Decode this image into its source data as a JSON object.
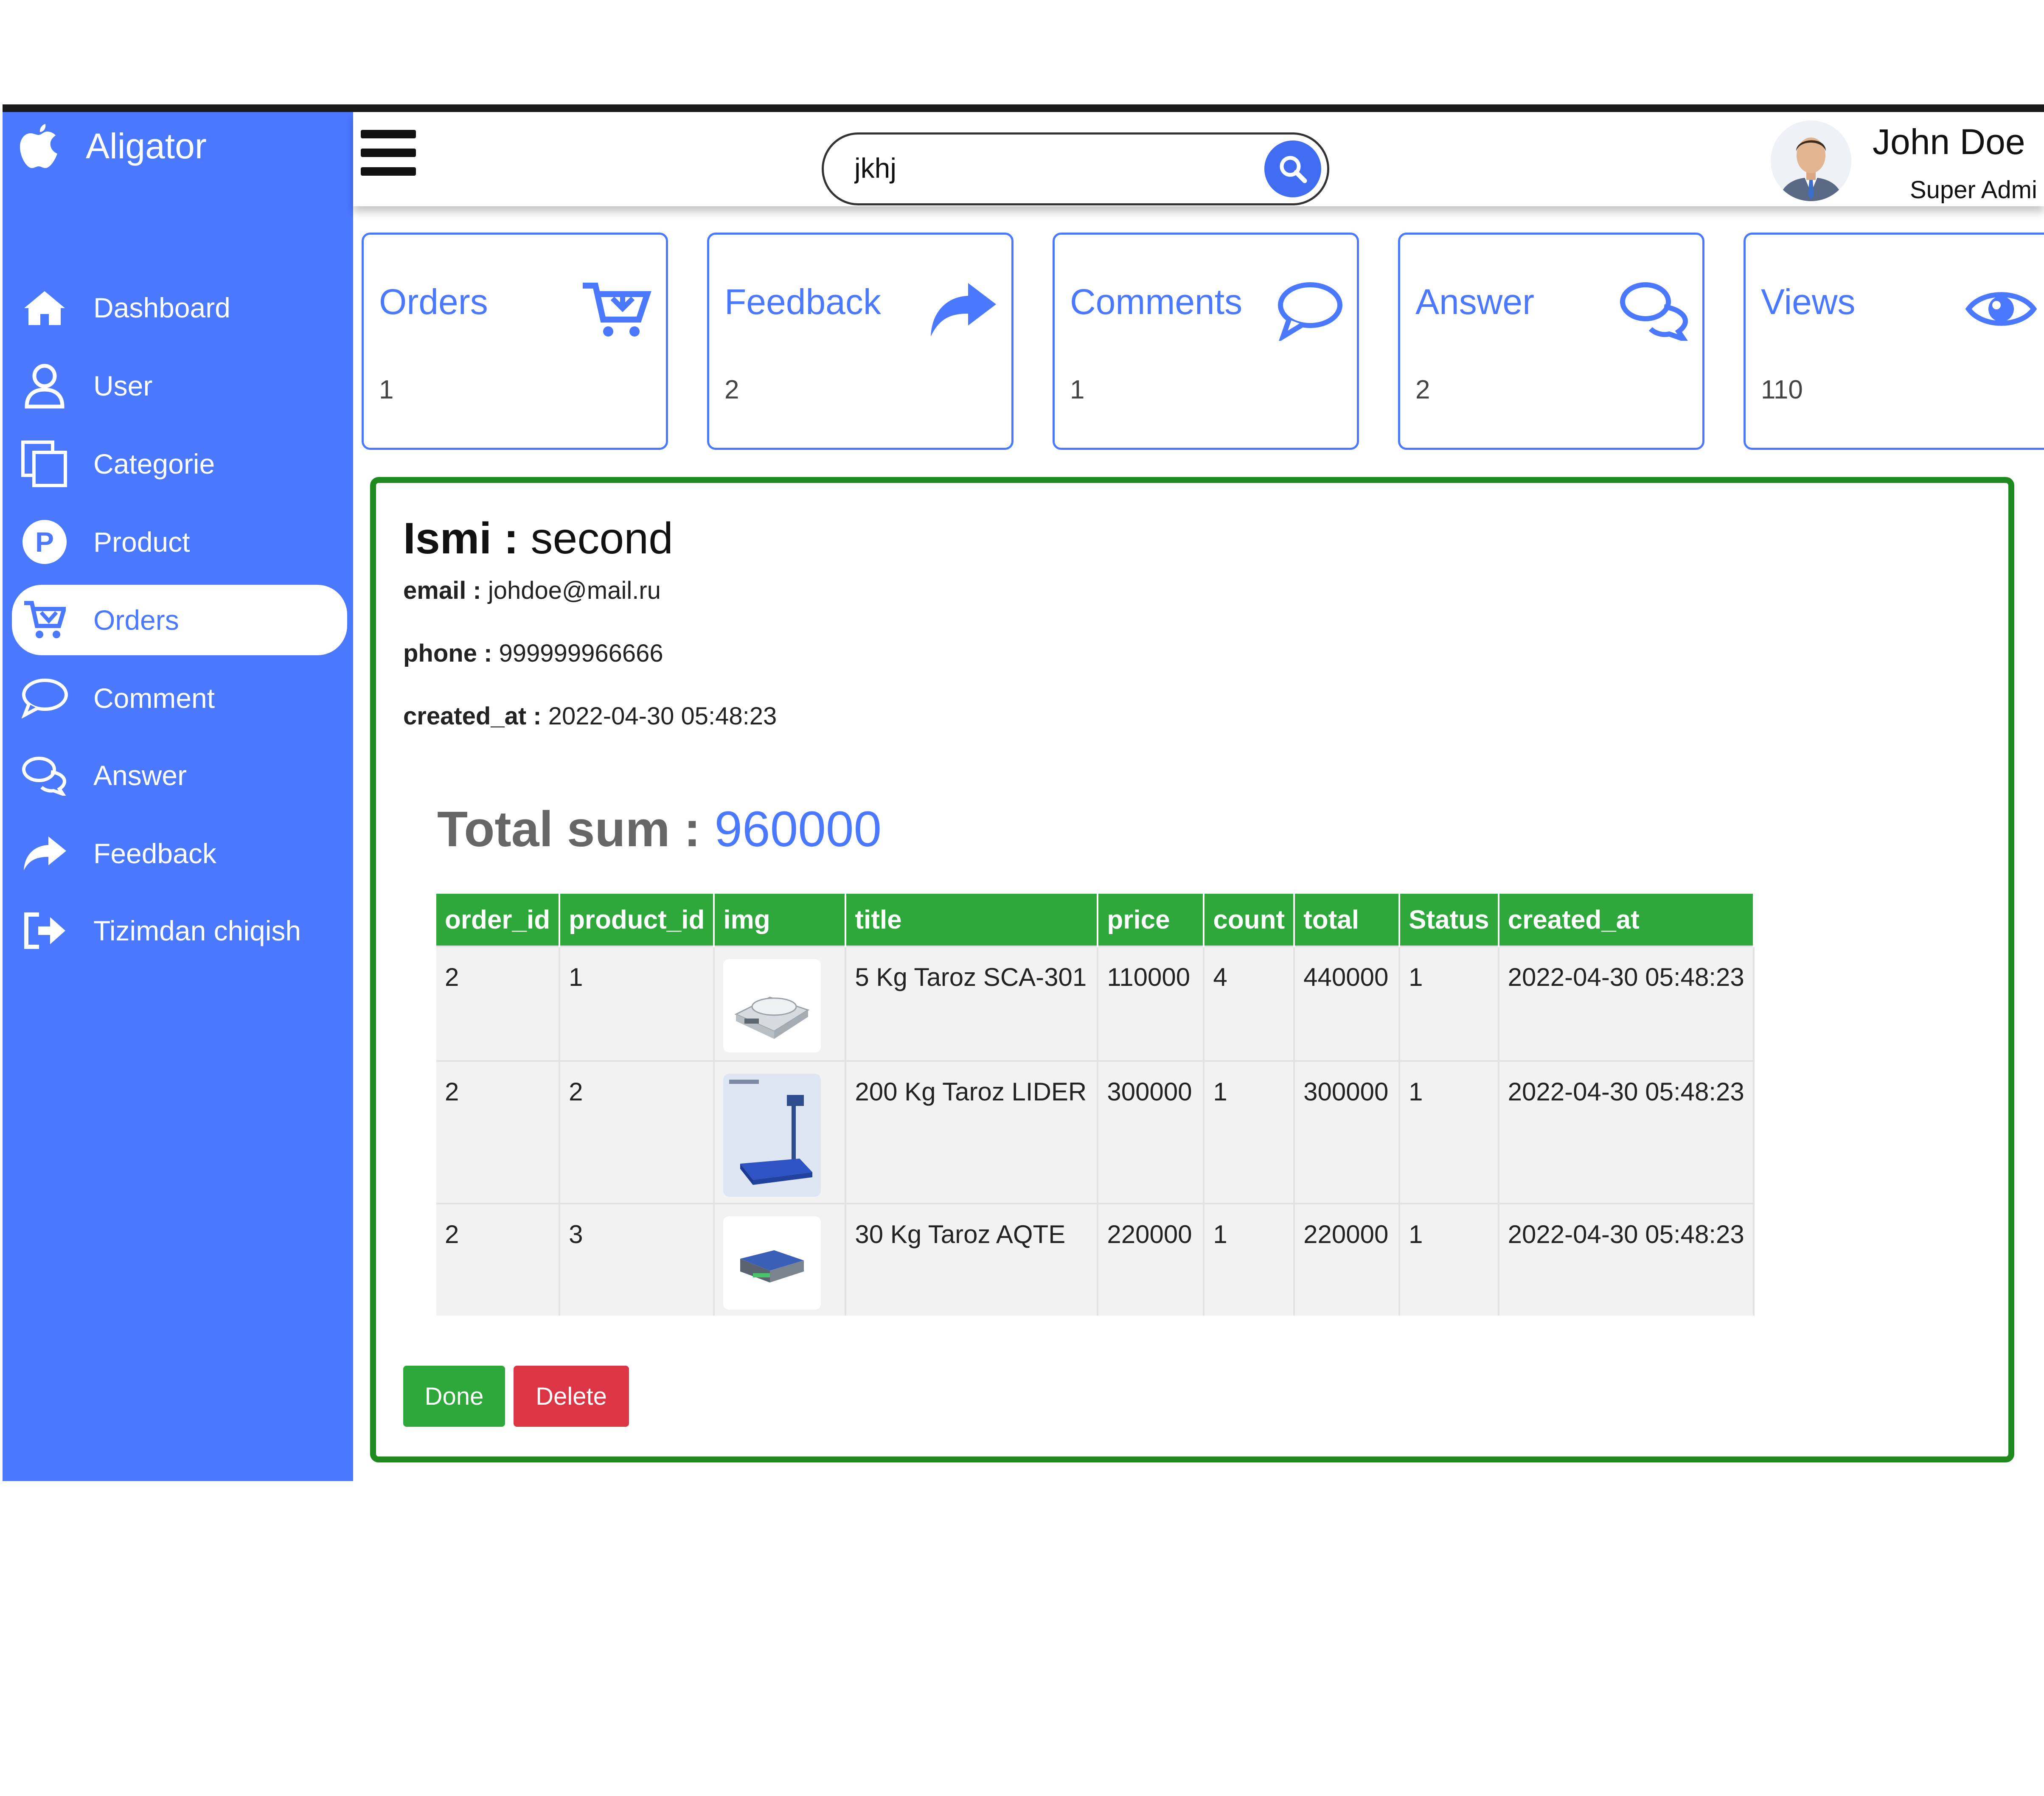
{
  "brand": {
    "name": "Aligator"
  },
  "sidebar": {
    "items": [
      {
        "label": "Dashboard",
        "icon": "home-icon"
      },
      {
        "label": "User",
        "icon": "user-icon"
      },
      {
        "label": "Categorie",
        "icon": "copy-icon"
      },
      {
        "label": "Product",
        "icon": "product-p-icon"
      },
      {
        "label": "Orders",
        "icon": "cart-icon",
        "active": true
      },
      {
        "label": "Comment",
        "icon": "comment-icon"
      },
      {
        "label": "Answer",
        "icon": "comments-icon"
      },
      {
        "label": "Feedback",
        "icon": "share-icon"
      },
      {
        "label": "Tizimdan chiqish",
        "icon": "sign-out-icon"
      }
    ]
  },
  "header": {
    "search": {
      "value": "jkhj"
    },
    "user": {
      "name": "John Doe",
      "role": "Super Admi"
    }
  },
  "cards": [
    {
      "title": "Orders",
      "value": "1",
      "icon": "cart-icon"
    },
    {
      "title": "Feedback",
      "value": "2",
      "icon": "share-icon"
    },
    {
      "title": "Comments",
      "value": "1",
      "icon": "comment-icon"
    },
    {
      "title": "Answer",
      "value": "2",
      "icon": "comments-icon"
    },
    {
      "title": "Views",
      "value": "110",
      "icon": "eye-icon"
    }
  ],
  "order": {
    "name_label": "Ismi :",
    "name": "second",
    "email_label": "email :",
    "email": "johdoe@mail.ru",
    "phone_label": "phone :",
    "phone": "999999966666",
    "created_label": "created_at :",
    "created": "2022-04-30 05:48:23",
    "total_label": "Total sum :",
    "total": "960000"
  },
  "table": {
    "headers": [
      "order_id",
      "product_id",
      "img",
      "title",
      "price",
      "count",
      "total",
      "Status",
      "created_at"
    ],
    "rows": [
      [
        "2",
        "1",
        "",
        "5 Kg Taroz SCA-301",
        "110000",
        "4",
        "440000",
        "1",
        "2022-04-30 05:48:23"
      ],
      [
        "2",
        "2",
        "",
        "200 Kg Taroz LIDER",
        "300000",
        "1",
        "300000",
        "1",
        "2022-04-30 05:48:23"
      ],
      [
        "2",
        "3",
        "",
        "30 Kg Taroz AQTE",
        "220000",
        "1",
        "220000",
        "1",
        "2022-04-30 05:48:23"
      ]
    ]
  },
  "actions": {
    "done": "Done",
    "delete": "Delete"
  },
  "colors": {
    "sidebar": "#4a78ff",
    "accent": "#4a78ff",
    "success": "#2ea83a",
    "danger": "#dc3545",
    "panel_border": "#1e8a1e"
  }
}
